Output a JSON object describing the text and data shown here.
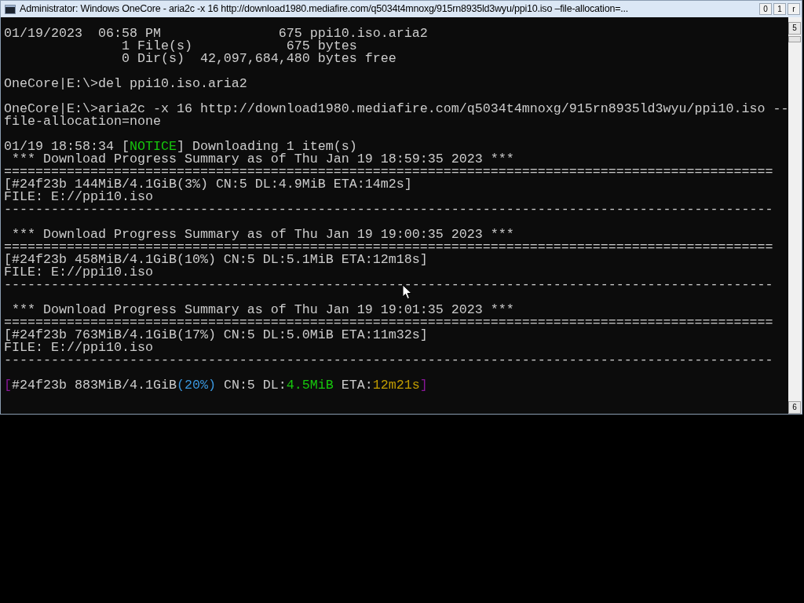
{
  "window": {
    "title": "Administrator:  Windows OneCore - aria2c  -x 16 http://download1980.mediafire.com/q5034t4mnoxg/915rn8935ld3wyu/ppi10.iso –file-allocation=...",
    "buttons": [
      "0",
      "1",
      "r"
    ]
  },
  "scrollbar": {
    "up": "5",
    "down": "6"
  },
  "console": {
    "lines": [
      {
        "kind": "text",
        "text": "01/19/2023  06:58 PM               675 ppi10.iso.aria2"
      },
      {
        "kind": "text",
        "text": "               1 File(s)            675 bytes"
      },
      {
        "kind": "text",
        "text": "               0 Dir(s)  42,097,684,480 bytes free"
      },
      {
        "kind": "blank"
      },
      {
        "kind": "text",
        "text": "OneCore|E:\\>del ppi10.iso.aria2"
      },
      {
        "kind": "blank"
      },
      {
        "kind": "text",
        "text": "OneCore|E:\\>aria2c -x 16 http://download1980.mediafire.com/q5034t4mnoxg/915rn8935ld3wyu/ppi10.iso --"
      },
      {
        "kind": "text",
        "text": "file-allocation=none"
      },
      {
        "kind": "blank"
      },
      {
        "kind": "segments",
        "segments": [
          {
            "text": "01/19 18:58:34 ["
          },
          {
            "text": "NOTICE",
            "color": "#16c60c"
          },
          {
            "text": "] Downloading 1 item(s)"
          }
        ]
      },
      {
        "kind": "text",
        "text": " *** Download Progress Summary as of Thu Jan 19 18:59:35 2023 ***"
      },
      {
        "kind": "text",
        "text": "=================================================================================================="
      },
      {
        "kind": "text",
        "text": "[#24f23b 144MiB/4.1GiB(3%) CN:5 DL:4.9MiB ETA:14m2s]"
      },
      {
        "kind": "text",
        "text": "FILE: E://ppi10.iso"
      },
      {
        "kind": "text",
        "text": "--------------------------------------------------------------------------------------------------"
      },
      {
        "kind": "blank"
      },
      {
        "kind": "text",
        "text": " *** Download Progress Summary as of Thu Jan 19 19:00:35 2023 ***"
      },
      {
        "kind": "text",
        "text": "=================================================================================================="
      },
      {
        "kind": "text",
        "text": "[#24f23b 458MiB/4.1GiB(10%) CN:5 DL:5.1MiB ETA:12m18s]"
      },
      {
        "kind": "text",
        "text": "FILE: E://ppi10.iso"
      },
      {
        "kind": "text",
        "text": "--------------------------------------------------------------------------------------------------"
      },
      {
        "kind": "blank"
      },
      {
        "kind": "text",
        "text": " *** Download Progress Summary as of Thu Jan 19 19:01:35 2023 ***"
      },
      {
        "kind": "text",
        "text": "=================================================================================================="
      },
      {
        "kind": "text",
        "text": "[#24f23b 763MiB/4.1GiB(17%) CN:5 DL:5.0MiB ETA:11m32s]"
      },
      {
        "kind": "text",
        "text": "FILE: E://ppi10.iso"
      },
      {
        "kind": "text",
        "text": "--------------------------------------------------------------------------------------------------"
      },
      {
        "kind": "blank"
      },
      {
        "kind": "segments",
        "segments": [
          {
            "text": "[",
            "color": "#881798"
          },
          {
            "text": "#24f23b 883MiB/4.1GiB"
          },
          {
            "text": "(20%)",
            "color": "#3a96dd"
          },
          {
            "text": " CN:5 DL:"
          },
          {
            "text": "4.5MiB",
            "color": "#16c60c"
          },
          {
            "text": " ETA:"
          },
          {
            "text": "12m21s",
            "color": "#c19c00"
          },
          {
            "text": "]",
            "color": "#881798"
          }
        ]
      }
    ]
  }
}
